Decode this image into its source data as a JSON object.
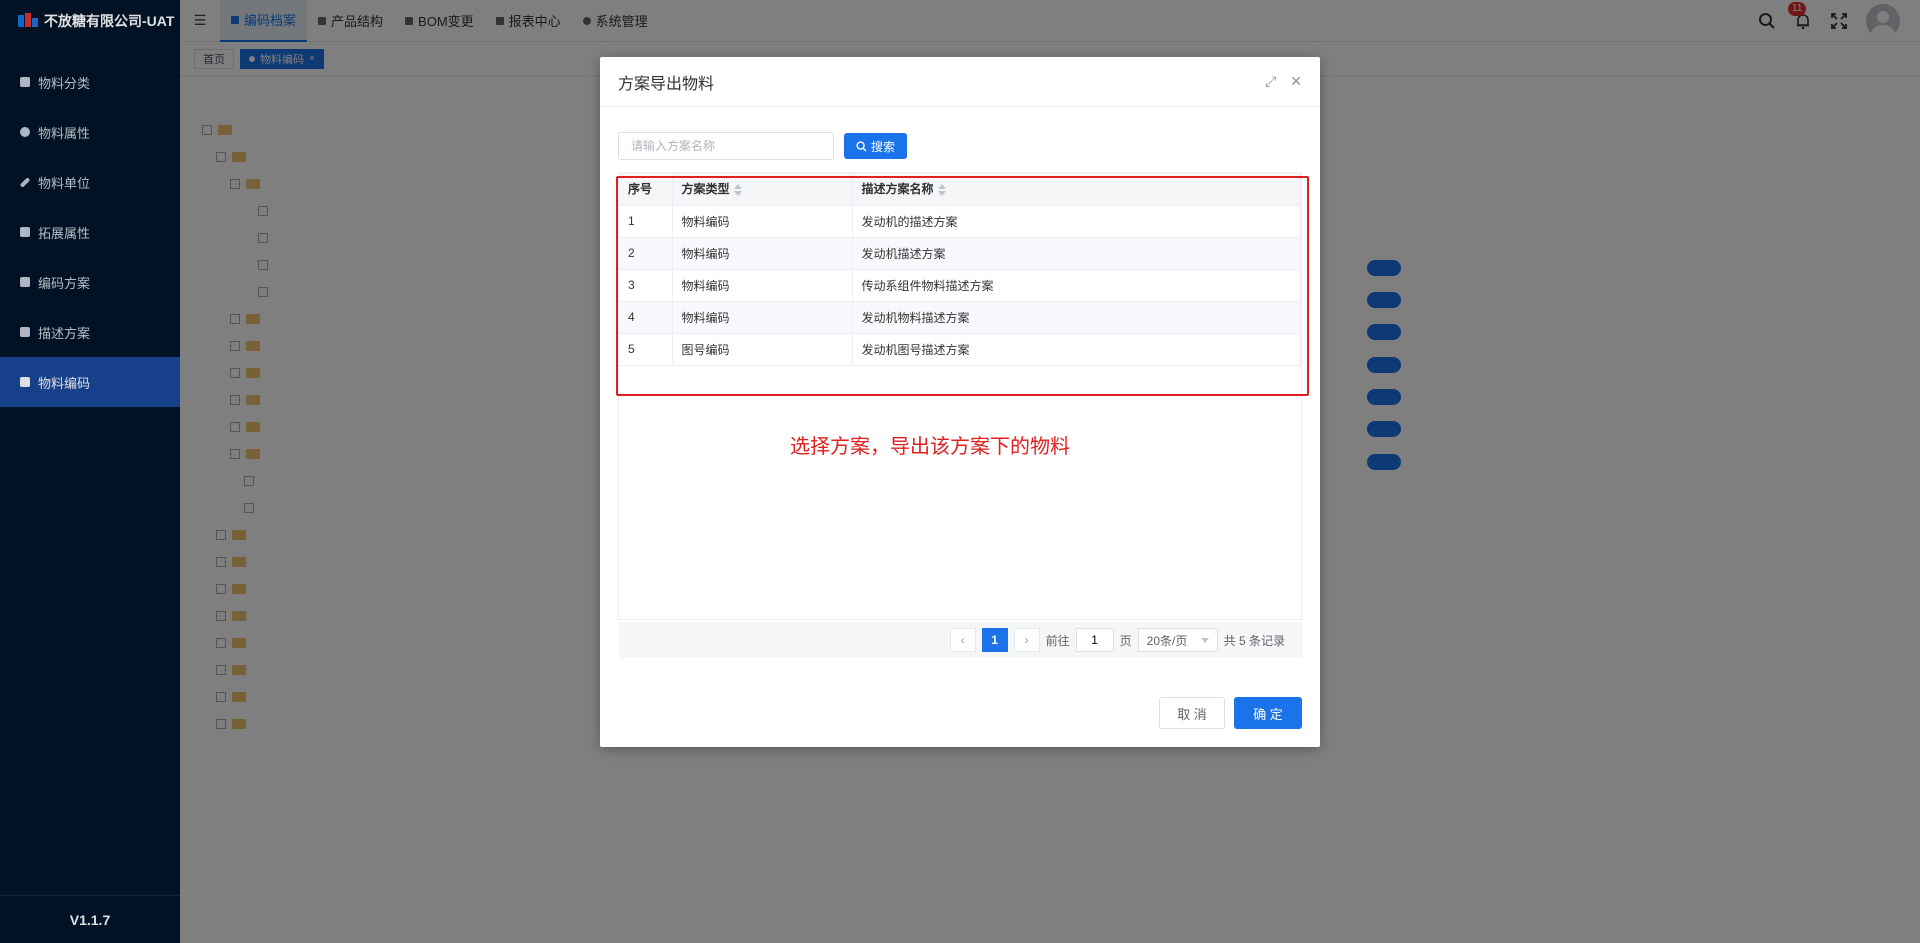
{
  "app": {
    "title": "不放糖有限公司-UAT",
    "version": "V1.1.7"
  },
  "sidebar": {
    "items": [
      {
        "label": "物料分类",
        "icon": "grid-icon"
      },
      {
        "label": "物料属性",
        "icon": "info-icon"
      },
      {
        "label": "物料单位",
        "icon": "pencil-icon"
      },
      {
        "label": "拓展属性",
        "icon": "image-icon"
      },
      {
        "label": "编码方案",
        "icon": "document-icon"
      },
      {
        "label": "描述方案",
        "icon": "document-icon"
      },
      {
        "label": "物料编码",
        "icon": "document-icon"
      }
    ]
  },
  "header": {
    "nav": [
      {
        "label": "编码档案"
      },
      {
        "label": "产品结构"
      },
      {
        "label": "BOM变更"
      },
      {
        "label": "报表中心"
      },
      {
        "label": "系统管理"
      }
    ],
    "notification_count": "11"
  },
  "tabs": [
    {
      "label": "首页"
    },
    {
      "label": "物料编码"
    }
  ],
  "dialog": {
    "title": "方案导出物料",
    "search": {
      "placeholder": "请输入方案名称",
      "button_label": "搜索"
    },
    "table": {
      "columns": [
        "序号",
        "方案类型",
        "描述方案名称"
      ],
      "rows": [
        {
          "index": "1",
          "type": "物料编码",
          "name": "发动机的描述方案"
        },
        {
          "index": "2",
          "type": "物料编码",
          "name": "发动机描述方案"
        },
        {
          "index": "3",
          "type": "物料编码",
          "name": "传动系组件物料描述方案"
        },
        {
          "index": "4",
          "type": "物料编码",
          "name": "发动机物料描述方案"
        },
        {
          "index": "5",
          "type": "图号编码",
          "name": "发动机图号描述方案"
        }
      ]
    },
    "annotation": "选择方案，导出该方案下的物料",
    "pager": {
      "current": "1",
      "goto_prefix": "前往",
      "goto_value": "1",
      "goto_suffix": "页",
      "page_size": "20条/页",
      "total": "共 5 条记录"
    },
    "cancel_label": "取 消",
    "ok_label": "确 定"
  },
  "colors": {
    "sidebar_bg": "#001529",
    "accent": "#1a73e8",
    "annotation_red": "#e02020"
  }
}
